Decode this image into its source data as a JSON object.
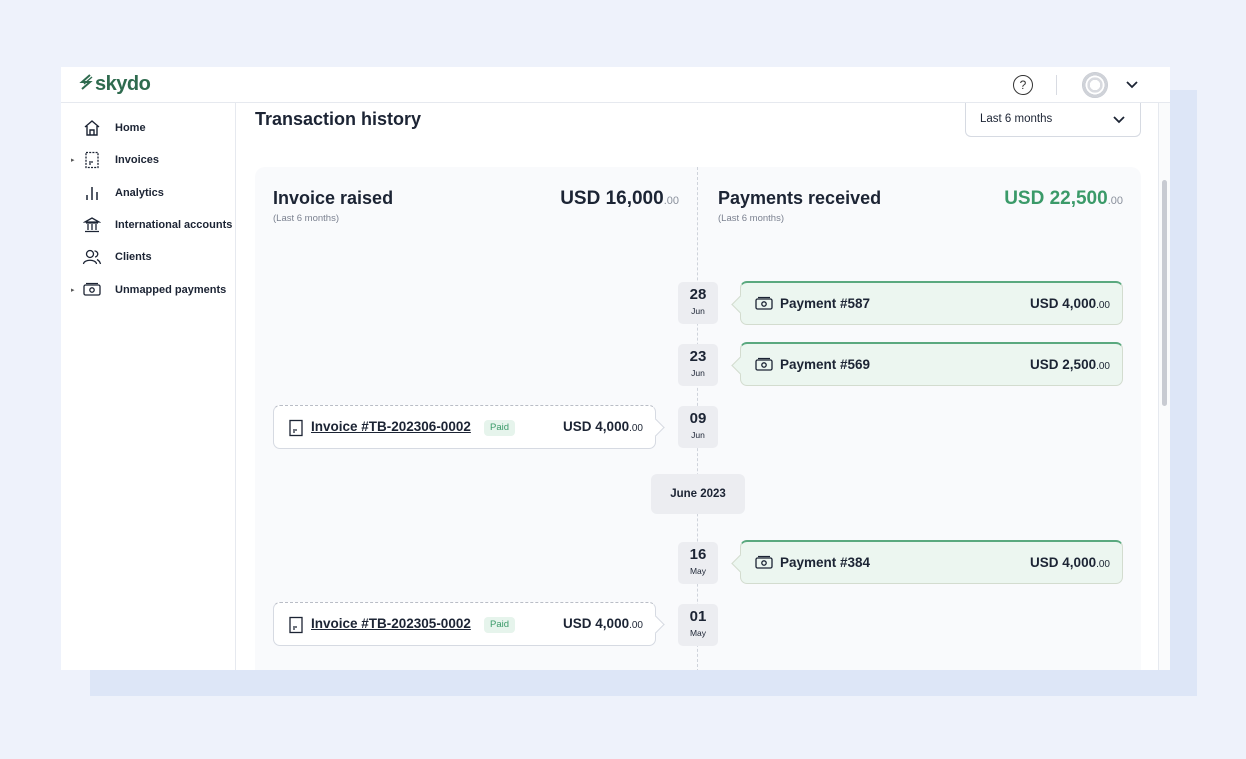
{
  "header": {
    "logo_text": "skydo",
    "help_glyph": "?",
    "icons": [
      "logo-s-icon",
      "help-circle-icon",
      "avatar",
      "chevron-down-icon"
    ]
  },
  "sidebar": {
    "items": [
      {
        "label": "Home",
        "icon": "home-icon",
        "expandable": false
      },
      {
        "label": "Invoices",
        "icon": "invoice-icon",
        "expandable": true
      },
      {
        "label": "Analytics",
        "icon": "analytics-icon",
        "expandable": false
      },
      {
        "label": "International accounts",
        "icon": "bank-icon",
        "expandable": false
      },
      {
        "label": "Clients",
        "icon": "clients-icon",
        "expandable": false
      },
      {
        "label": "Unmapped payments",
        "icon": "cash-icon",
        "expandable": true
      }
    ]
  },
  "main": {
    "title": "Transaction history",
    "range_select": {
      "value": "Last 6 months"
    },
    "invoice_summary": {
      "title": "Invoice raised",
      "subtitle": "(Last 6 months)",
      "amount": "USD 16,000",
      "cents": ".00"
    },
    "payments_summary": {
      "title": "Payments received",
      "subtitle": "(Last 6 months)",
      "amount": "USD 22,500",
      "cents": ".00"
    },
    "month_separator": "June 2023",
    "timeline": [
      {
        "day": "28",
        "month": "Jun",
        "type": "payment",
        "label": "Payment #587",
        "amount": "USD 4,000",
        "cents": ".00"
      },
      {
        "day": "23",
        "month": "Jun",
        "type": "payment",
        "label": "Payment #569",
        "amount": "USD 2,500",
        "cents": ".00"
      },
      {
        "day": "09",
        "month": "Jun",
        "type": "invoice",
        "label": "Invoice #TB-202306-0002",
        "status": "Paid",
        "amount": "USD 4,000",
        "cents": ".00"
      },
      {
        "day": "16",
        "month": "May",
        "type": "payment",
        "label": "Payment #384",
        "amount": "USD 4,000",
        "cents": ".00"
      },
      {
        "day": "01",
        "month": "May",
        "type": "invoice",
        "label": "Invoice #TB-202305-0002",
        "status": "Paid",
        "amount": "USD 4,000",
        "cents": ".00"
      }
    ]
  },
  "colors": {
    "brand": "#2f6b4f",
    "positive": "#3b9a69",
    "page_bg": "#eef2fb"
  }
}
